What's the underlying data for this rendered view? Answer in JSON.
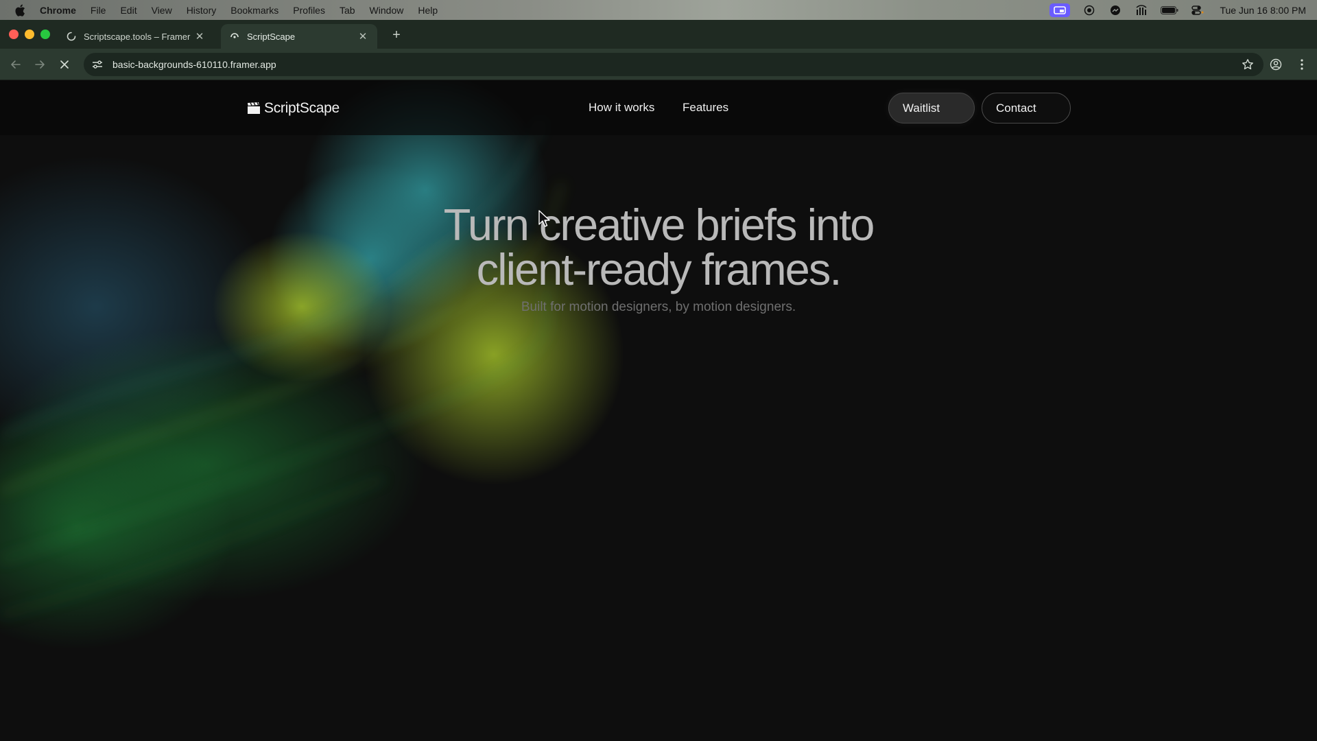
{
  "menubar": {
    "app_name": "Chrome",
    "items": [
      "File",
      "Edit",
      "View",
      "History",
      "Bookmarks",
      "Profiles",
      "Tab",
      "Window",
      "Help"
    ],
    "datetime": "Tue Jun 16  8:00 PM"
  },
  "tabs": [
    {
      "title": "Scriptscape.tools – Framer",
      "state": "loading"
    },
    {
      "title": "ScriptScape",
      "state": "active"
    }
  ],
  "address_bar": {
    "url": "basic-backgrounds-610110.framer.app"
  },
  "site": {
    "logo_text": "ScriptScape",
    "nav_links": [
      "How it works",
      "Features"
    ],
    "buttons": {
      "waitlist": "Waitlist",
      "contact": "Contact"
    }
  },
  "hero": {
    "title_line1": "Turn creative briefs into",
    "title_line2": "client-ready frames.",
    "subtitle": "Built for motion designers, by motion designers."
  },
  "colors": {
    "page_background": "#0e0e0e",
    "hero_title": "#b9b9b9",
    "hero_subtitle": "#6f6f6f",
    "art_teal": "#2e8f94",
    "art_lime": "#a7c52a",
    "art_green": "#1f8a3a",
    "tab_bar": "#1f2a22",
    "toolbar": "#2c3a30",
    "status_purple": "#6a5cff"
  },
  "icons": {
    "menubar_right": [
      "screen-share-icon",
      "record-icon",
      "messenger-icon",
      "hotspot-icon",
      "battery-icon",
      "control-center-icon"
    ],
    "toolbar": [
      "back-icon",
      "forward-icon",
      "stop-loading-icon",
      "site-info-icon",
      "bookmark-star-icon",
      "profile-icon",
      "more-menu-icon"
    ]
  }
}
